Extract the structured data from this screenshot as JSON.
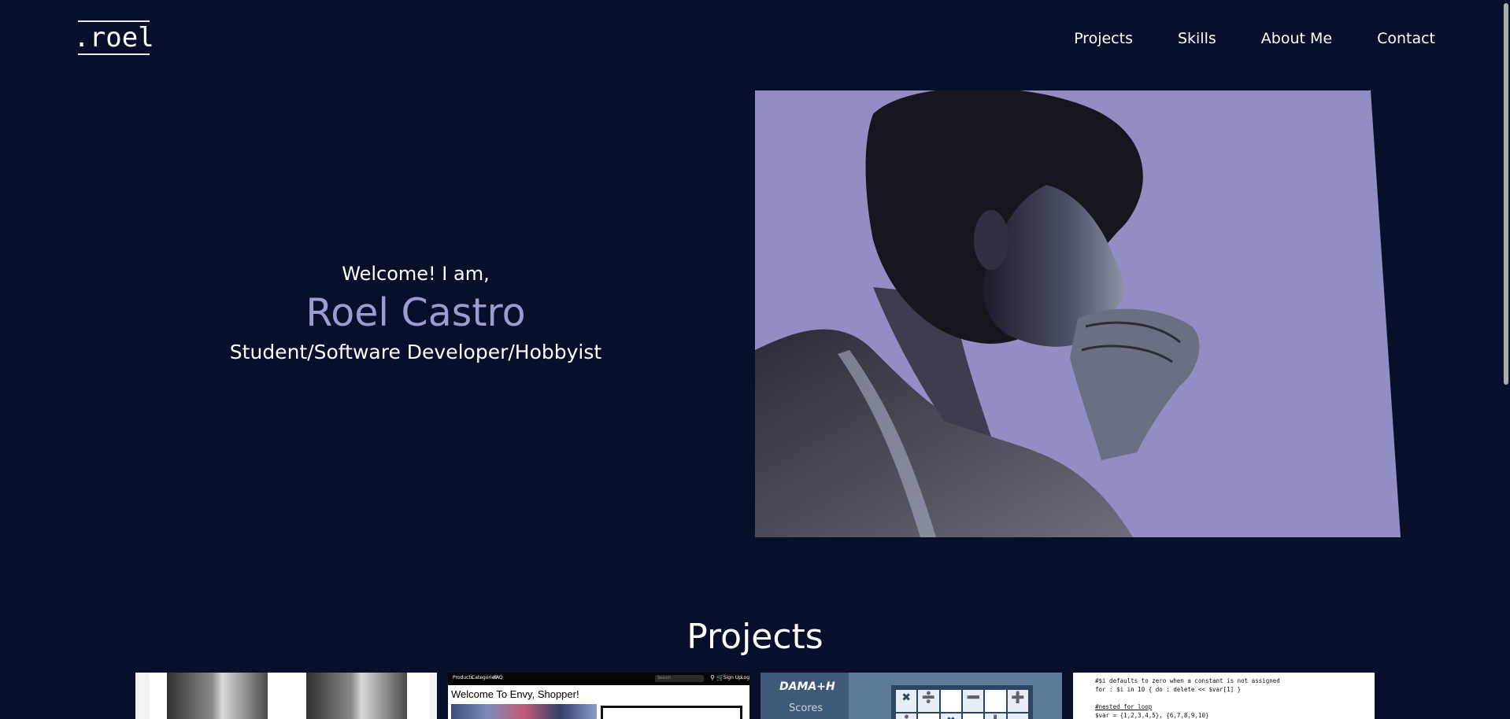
{
  "header": {
    "logo_text": ".roel",
    "nav": [
      "Projects",
      "Skills",
      "About Me",
      "Contact"
    ]
  },
  "hero": {
    "greeting": "Welcome! I am,",
    "name": "Roel Castro",
    "role": "Student/Software Developer/Hobbyist"
  },
  "projects": {
    "title": "Projects",
    "card2": {
      "nav_items": [
        "Products",
        "Categories",
        "FAQ"
      ],
      "search_placeholder": "Search",
      "account_links": [
        "Sign Up",
        "Log"
      ],
      "welcome": "Welcome To Envy, Shopper!"
    },
    "card3": {
      "brand": "DAMA+H",
      "scores": "Scores",
      "cells": [
        "✖",
        "➗",
        "",
        "➖",
        "",
        "➕",
        "➗",
        "",
        "✖",
        "",
        "➕",
        "➖"
      ]
    },
    "card4": {
      "lines": [
        "#$i defaults to zero when a constant is not assigned",
        "for : $i in 10 { do : delete << $var[1] }",
        "",
        "#nested for loop",
        "$var = {1,2,3,4,5}, {6,7,8,9,10}"
      ]
    }
  },
  "colors": {
    "background": "#080f2b",
    "accent": "#9d9bd2",
    "portrait_bg": "#908ec2"
  },
  "icons": [
    "cart-icon",
    "search-icon"
  ]
}
